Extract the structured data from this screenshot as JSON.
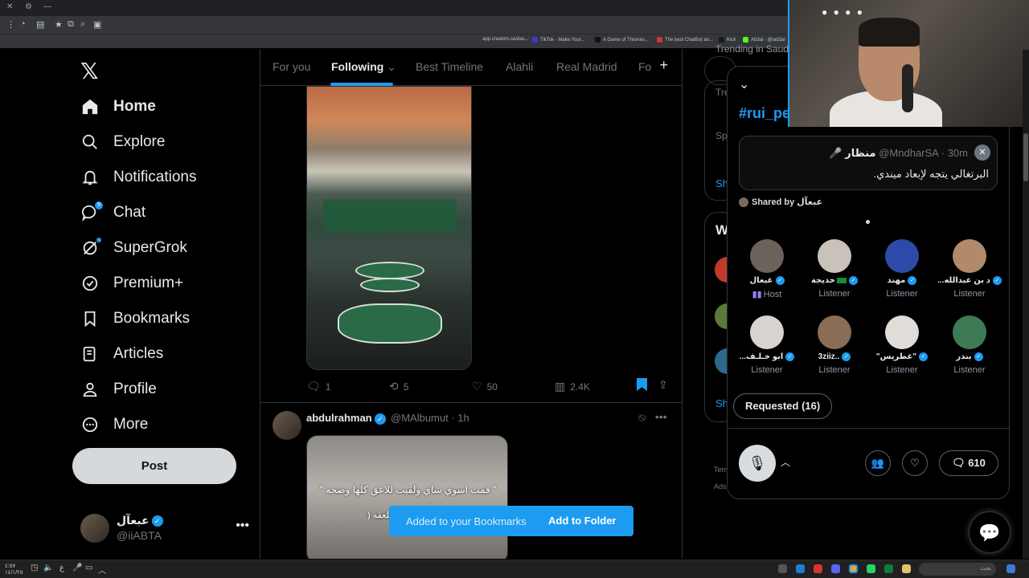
{
  "browser": {
    "bookmarks": [
      {
        "label": "app.creators.sa/das...",
        "color": "#999999"
      },
      {
        "label": "TikTok - Make Your...",
        "color": "#3b3bd0"
      },
      {
        "label": "A Game of Thrones...",
        "color": "#111111"
      },
      {
        "label": "The best ChatBot an...",
        "color": "#d33333"
      },
      {
        "label": "Kick",
        "color": "#1a1a1a"
      },
      {
        "label": "Ab3al - @iab3al",
        "color": "#53fc18"
      }
    ]
  },
  "nav": {
    "items": [
      {
        "label": "Home",
        "icon": "home-icon"
      },
      {
        "label": "Explore",
        "icon": "search-icon"
      },
      {
        "label": "Notifications",
        "icon": "bell-icon"
      },
      {
        "label": "Chat",
        "icon": "chat-icon",
        "badge": "9"
      },
      {
        "label": "SuperGrok",
        "icon": "grok-icon"
      },
      {
        "label": "Premium+",
        "icon": "verified-badge-icon"
      },
      {
        "label": "Bookmarks",
        "icon": "bookmark-icon"
      },
      {
        "label": "Articles",
        "icon": "articles-icon"
      },
      {
        "label": "Profile",
        "icon": "person-icon"
      },
      {
        "label": "More",
        "icon": "more-circle-icon"
      }
    ],
    "post_label": "Post",
    "account": {
      "name": "عبعآل",
      "handle": "@iiABTA"
    }
  },
  "feed": {
    "tabs": [
      "For you",
      "Following",
      "Best Timeline",
      "Alahli",
      "Real Madrid",
      "Fo"
    ],
    "tweet1": {
      "replies": "1",
      "reposts": "5",
      "likes": "50",
      "views": "2.4K"
    },
    "tweet2": {
      "name": "abdulrahman",
      "handle": "@MAlbumut",
      "time": "1h",
      "caption": "\" قمت اسوي شاي ولقيت للاعق كلها وصخه \"",
      "caption2": "ملعقه ("
    },
    "toast": {
      "message": "Added to your Bookmarks",
      "action": "Add to Folder"
    }
  },
  "right": {
    "fragments": [
      "Trending in Saudi",
      "Tre",
      "Spo",
      "Sh",
      "W",
      "Sh",
      "Terms",
      "Ads"
    ]
  },
  "space": {
    "hashtag": "#rui_pe",
    "pinned": {
      "author": "منظار",
      "handle": "@MndharSA",
      "time": "30m",
      "message": "البرتغالي يتجه لإبعاد ميندي."
    },
    "shared_by": "Shared by",
    "shared_name": "عبعآل",
    "speakers": [
      {
        "name": "عبعآل",
        "role": "Host",
        "color": "#6b6259"
      },
      {
        "name": "خديجة",
        "role": "Listener",
        "color": "#c8c2bb"
      },
      {
        "name": "مهند",
        "role": "Listener",
        "color": "#2e4aa8"
      },
      {
        "name": "...د بن عبدالله",
        "role": "Listener",
        "color": "#b08a6a"
      },
      {
        "name": "...ابو خـلـف",
        "role": "Listener",
        "color": "#d8d4cf"
      },
      {
        "name": "3ziiz..",
        "role": "Listener",
        "color": "#8a6d55"
      },
      {
        "name": "\"غطريس\"",
        "role": "Listener",
        "color": "#e0ddd8"
      },
      {
        "name": "بندر",
        "role": "Listener",
        "color": "#3f7a57"
      }
    ],
    "requested_label": "Requested (16)",
    "comments_count": "610"
  },
  "taskbar": {
    "search_placeholder": "بحث",
    "time": "٤:٥٧",
    "date": "١٤/١/٢٥"
  }
}
